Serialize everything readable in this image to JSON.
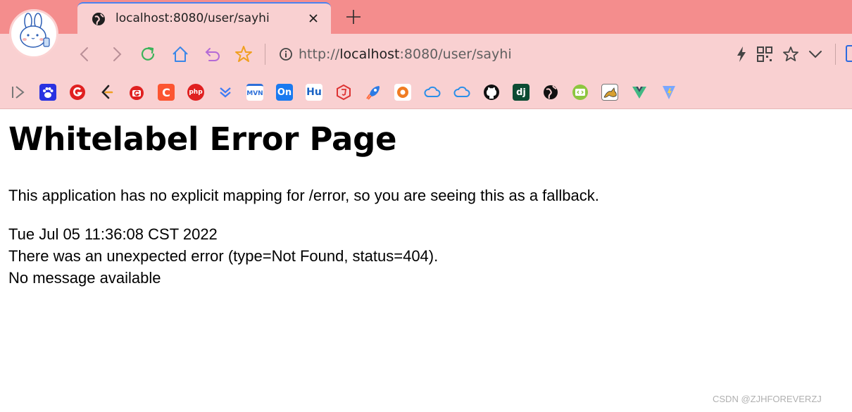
{
  "tab": {
    "title": "localhost:8080/user/sayhi",
    "favicon": "globe-icon"
  },
  "toolbar": {
    "url_scheme": "http://",
    "url_host": "localhost",
    "url_rest": ":8080/user/sayhi"
  },
  "bookmarks": [
    {
      "icon": "paw-icon",
      "color": "#2932e1"
    },
    {
      "icon": "g-logo-icon",
      "color": "#e02020"
    },
    {
      "icon": "leetcode-icon",
      "color": "#f0a020"
    },
    {
      "icon": "bilibili-g-icon",
      "color": "#e02020"
    },
    {
      "icon": "c-logo-icon",
      "color": "#fc5531",
      "text": "C"
    },
    {
      "icon": "php-icon",
      "color": "#e02020",
      "text": "php"
    },
    {
      "icon": "chevrons-down-icon",
      "color": "#3c7bf5"
    },
    {
      "icon": "mvn-icon",
      "color": "#2d6fd8",
      "text": "MVN"
    },
    {
      "icon": "on-icon",
      "color": "#1a7af0",
      "text": "On"
    },
    {
      "icon": "hu-icon",
      "color": "#1a63c4",
      "text": "Hu"
    },
    {
      "icon": "html5-icon",
      "color": "#d33"
    },
    {
      "icon": "rocket-icon",
      "color": "#2c7be5"
    },
    {
      "icon": "gitee-icon",
      "color": "#c71d23"
    },
    {
      "icon": "cloud-icon",
      "color": "#2b8fe8"
    },
    {
      "icon": "cloud-icon",
      "color": "#2b8fe8"
    },
    {
      "icon": "github-icon",
      "color": "#111111"
    },
    {
      "icon": "django-icon",
      "color": "#0c4b33",
      "text": "dj"
    },
    {
      "icon": "globe-icon",
      "color": "#111111"
    },
    {
      "icon": "code-icon",
      "color": "#8dc63f"
    },
    {
      "icon": "tomcat-icon",
      "color": "#d8a030"
    },
    {
      "icon": "vue-icon",
      "color": "#41b883"
    },
    {
      "icon": "vite-icon",
      "color": "#7aa7ff"
    }
  ],
  "page": {
    "heading": "Whitelabel Error Page",
    "description": "This application has no explicit mapping for /error, so you are seeing this as a fallback.",
    "timestamp": "Tue Jul 05 11:36:08 CST 2022",
    "error": "There was an unexpected error (type=Not Found, status=404).",
    "message": "No message available"
  },
  "watermark": "CSDN @ZJHFOREVERZJ"
}
